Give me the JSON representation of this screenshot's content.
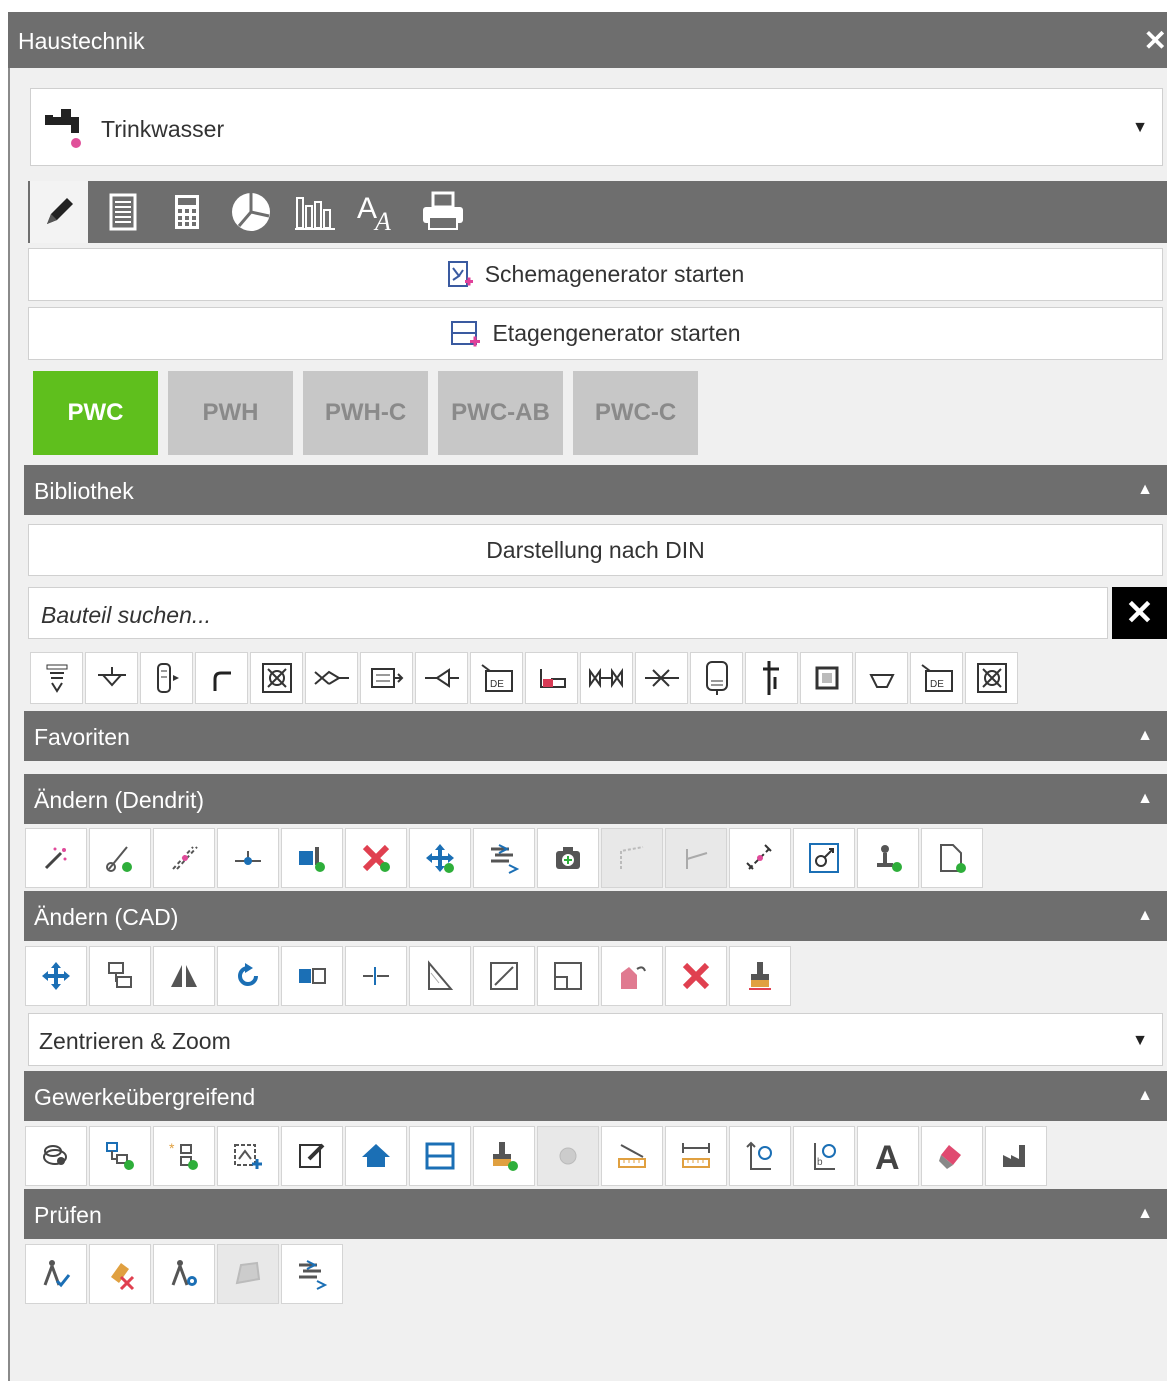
{
  "window": {
    "title": "Haustechnik",
    "close_icon": "close-icon"
  },
  "medium": {
    "selected": "Trinkwasser",
    "icon": "faucet-icon"
  },
  "tabs": [
    {
      "icon": "pencil-icon",
      "active": true
    },
    {
      "icon": "list-icon"
    },
    {
      "icon": "calculator-icon"
    },
    {
      "icon": "pie-chart-icon"
    },
    {
      "icon": "bar-chart-icon"
    },
    {
      "icon": "text-style-icon"
    },
    {
      "icon": "printer-icon"
    }
  ],
  "actions": {
    "schema": "Schemagenerator starten",
    "etage": "Etagengenerator starten"
  },
  "zones": [
    {
      "label": "PWC",
      "active": true
    },
    {
      "label": "PWH"
    },
    {
      "label": "PWH-C"
    },
    {
      "label": "PWC-AB"
    },
    {
      "label": "PWC-C"
    }
  ],
  "sections": {
    "bibliothek": "Bibliothek",
    "favoriten": "Favoriten",
    "aendern_dendrit": "Ändern (Dendrit)",
    "aendern_cad": "Ändern (CAD)",
    "gewerk": "Gewerkeübergreifend",
    "pruefen": "Prüfen"
  },
  "library": {
    "display_mode": "Darstellung nach DIN",
    "search_placeholder": "Bauteil suchen...",
    "clear_label": "✕"
  },
  "zoom": {
    "selected": "Zentrieren & Zoom"
  },
  "colors": {
    "active_zone": "#5fbf1d",
    "header": "#6e6e6e",
    "accent_green": "#2eae3a",
    "accent_red": "#e04050",
    "accent_blue": "#1b6fb5"
  }
}
